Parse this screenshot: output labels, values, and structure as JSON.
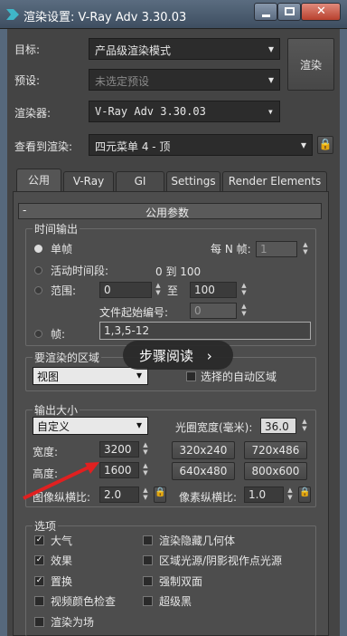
{
  "window": {
    "title": "渲染设置: V-Ray Adv 3.30.03"
  },
  "header": {
    "target_label": "目标:",
    "target_value": "产品级渲染模式",
    "preset_label": "预设:",
    "preset_value": "未选定预设",
    "renderer_label": "渲染器:",
    "renderer_value": "V-Ray Adv 3.30.03",
    "view_label": "查看到渲染:",
    "view_value": "四元菜单 4 - 顶",
    "render_button": "渲染"
  },
  "tabs": [
    "公用",
    "V-Ray",
    "GI",
    "Settings",
    "Render Elements"
  ],
  "rollout": {
    "title": "公用参数",
    "collapse": "-"
  },
  "time_output": {
    "title": "时间输出",
    "single": "单帧",
    "every_n_label": "每 N 帧:",
    "every_n_value": "1",
    "active_segment": "活动时间段:",
    "active_range": "0 到 100",
    "range": "范围:",
    "range_from": "0",
    "range_to_label": "至",
    "range_to": "100",
    "file_start_label": "文件起始编号:",
    "file_start_value": "0",
    "frames": "帧:",
    "frames_value": "1,3,5-12"
  },
  "render_area": {
    "title": "要渲染的区域",
    "value": "视图",
    "auto_region": "选择的自动区域"
  },
  "output_size": {
    "title": "输出大小",
    "preset": "自定义",
    "aperture_label": "光圈宽度(毫米):",
    "aperture_value": "36.0",
    "width_label": "宽度:",
    "width_value": "3200",
    "height_label": "高度:",
    "height_value": "1600",
    "presets": [
      "320x240",
      "720x486",
      "640x480",
      "800x600"
    ],
    "image_aspect_label": "图像纵横比:",
    "image_aspect_value": "2.0",
    "pixel_aspect_label": "像素纵横比:",
    "pixel_aspect_value": "1.0"
  },
  "options": {
    "title": "选项",
    "left": [
      {
        "label": "大气",
        "checked": true
      },
      {
        "label": "效果",
        "checked": true
      },
      {
        "label": "置换",
        "checked": true
      },
      {
        "label": "视频颜色检查",
        "checked": false
      },
      {
        "label": "渲染为场",
        "checked": false
      }
    ],
    "right": [
      {
        "label": "渲染隐藏几何体",
        "checked": false
      },
      {
        "label": "区域光源/阴影视作点光源",
        "checked": false
      },
      {
        "label": "强制双面",
        "checked": false
      },
      {
        "label": "超级黑",
        "checked": false
      }
    ]
  },
  "tooltip": {
    "text": "步骤阅读",
    "chevron": "›"
  },
  "colors": {
    "annotation_arrow": "#e02020",
    "accent_text": "#dcdcdc"
  }
}
